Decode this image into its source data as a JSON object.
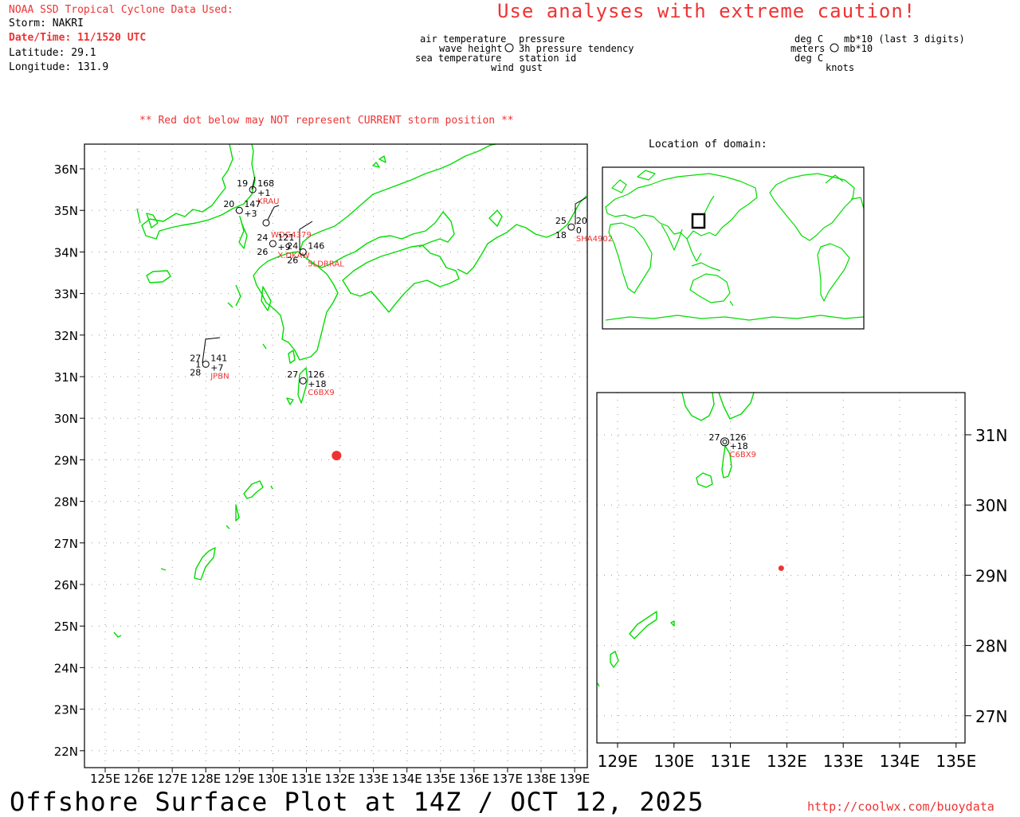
{
  "header": {
    "source": "NOAA SSD Tropical Cyclone Data Used:",
    "storm": "Storm: NAKRI",
    "datetime": "Date/Time: 11/1520 UTC",
    "latitude": "Latitude: 29.1",
    "longitude": "Longitude: 131.9",
    "caution": "Use analyses with extreme caution!"
  },
  "legend_station": {
    "air_temperature": "air temperature",
    "wave_height": "wave height",
    "sea_temperature": "sea temperature",
    "wind_gust": "wind gust",
    "pressure": "pressure",
    "pressure_tendency": "3h pressure tendency",
    "station_id": "station id"
  },
  "legend_units": {
    "deg_c_top": "deg C",
    "meters": "meters",
    "deg_c_bottom": "deg C",
    "mb_top": "mb*10 (last 3 digits)",
    "mb_bottom": "mb*10",
    "knots": "knots"
  },
  "warning": "** Red dot below may NOT represent CURRENT storm position **",
  "inset_title": "Location of domain:",
  "footer": {
    "title": "Offshore Surface Plot at 14Z / OCT 12, 2025",
    "url": "http://coolwx.com/buoydata"
  },
  "colors": {
    "land": "#00dd00",
    "storm": "#ee3333",
    "text_red": "#ee3333",
    "grid": "#999999"
  },
  "main_map": {
    "lat_labels": [
      "36N",
      "35N",
      "34N",
      "33N",
      "32N",
      "31N",
      "30N",
      "29N",
      "28N",
      "27N",
      "26N",
      "25N",
      "24N",
      "23N",
      "22N"
    ],
    "lon_labels": [
      "125E",
      "126E",
      "127E",
      "128E",
      "129E",
      "130E",
      "131E",
      "132E",
      "133E",
      "134E",
      "135E",
      "136E",
      "137E",
      "138E",
      "139E"
    ]
  },
  "zoom_map": {
    "lat_labels": [
      "31N",
      "30N",
      "29N",
      "28N",
      "27N"
    ],
    "lon_labels": [
      "129E",
      "130E",
      "131E",
      "132E",
      "133E",
      "134E",
      "135E"
    ]
  },
  "storm_position": {
    "lat": 29.1,
    "lon": 131.9
  },
  "stations": [
    {
      "id": "KRAU",
      "lat": 35.5,
      "lon": 129.4,
      "air": "19",
      "pressure": "168",
      "tendency": "+1"
    },
    {
      "id": "",
      "lat": 35.0,
      "lon": 129.0,
      "air": "20",
      "pressure": "147",
      "tendency": "+3"
    },
    {
      "id": "WDG4379",
      "lat": 34.7,
      "lon": 129.8,
      "air": "",
      "pressure": "",
      "tendency": ""
    },
    {
      "id": "X.DKAW",
      "lat": 34.2,
      "lon": 130.0,
      "air": "24",
      "wave": "",
      "sea": "26",
      "pressure": "121",
      "tendency": "+9"
    },
    {
      "id": "5LDRRAL",
      "lat": 34.0,
      "lon": 130.9,
      "air": "24",
      "sea": "26",
      "pressure": "146",
      "tendency": ""
    },
    {
      "id": "SHA4902",
      "lat": 34.6,
      "lon": 138.9,
      "air": "25",
      "sea": "18",
      "pressure": "20",
      "tendency": "0"
    },
    {
      "id": "JPBN",
      "lat": 31.3,
      "lon": 128.0,
      "air": "27",
      "wave": "1",
      "sea": "28",
      "pressure": "141",
      "tendency": "+7"
    },
    {
      "id": "C6BX9",
      "lat": 30.9,
      "lon": 130.9,
      "air": "27",
      "pressure": "126",
      "tendency": "+18"
    }
  ]
}
